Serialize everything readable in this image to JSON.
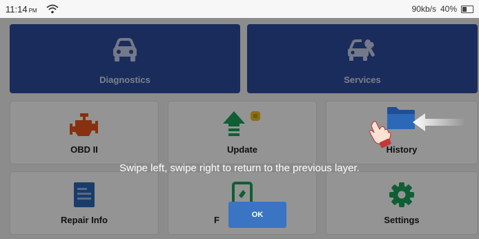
{
  "status_bar": {
    "time": "11:14",
    "ampm": "PM",
    "network_speed": "90kb/s",
    "battery": "40%",
    "battery_level": 0.4
  },
  "tiles": {
    "diagnostics": {
      "label": "Diagnostics",
      "icon": "car-icon"
    },
    "services": {
      "label": "Services",
      "icon": "car-wrench-icon"
    },
    "obd2": {
      "label": "OBD II",
      "icon": "engine-icon"
    },
    "update": {
      "label": "Update",
      "icon": "upload-arrow-icon",
      "badge": "0"
    },
    "history": {
      "label": "History",
      "icon": "folder-icon"
    },
    "repair_info": {
      "label": "Repair Info",
      "icon": "document-icon"
    },
    "feedback": {
      "label": "F",
      "icon": "feedback-icon"
    },
    "settings": {
      "label": "Settings",
      "icon": "gear-icon"
    }
  },
  "tutorial": {
    "message": "Swipe left, swipe right to return to the previous layer.",
    "ok_label": "OK"
  },
  "colors": {
    "primary": "#2d4d9e",
    "ok_button": "#3975c2",
    "update_icon": "#1aa35b",
    "engine_icon": "#e8551c",
    "folder_icon": "#2b68b8"
  }
}
